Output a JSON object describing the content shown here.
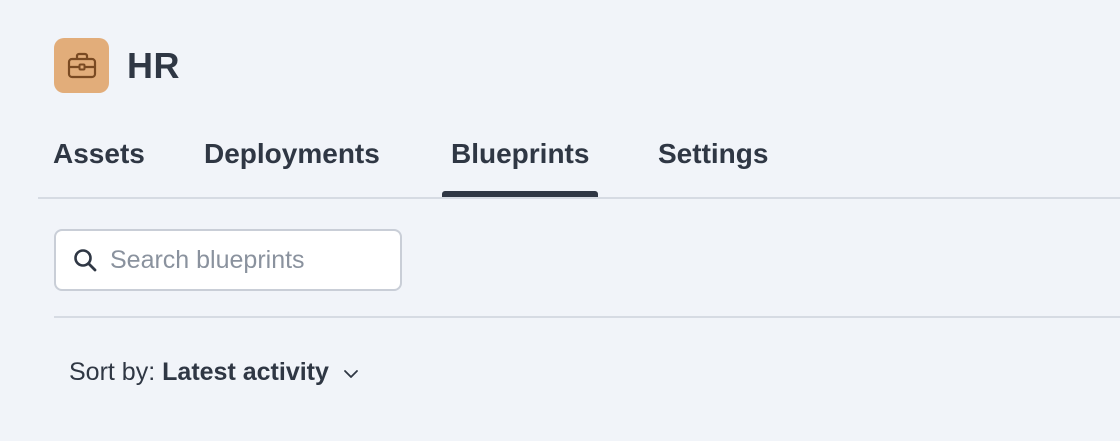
{
  "header": {
    "title": "HR",
    "icon": "briefcase-icon",
    "icon_bg": "#e2ad7a"
  },
  "tabs": [
    {
      "label": "Assets",
      "active": false
    },
    {
      "label": "Deployments",
      "active": false
    },
    {
      "label": "Blueprints",
      "active": true
    },
    {
      "label": "Settings",
      "active": false
    }
  ],
  "search": {
    "placeholder": "Search blueprints",
    "value": "",
    "icon": "search-icon"
  },
  "sort": {
    "label": "Sort by:",
    "value": "Latest activity",
    "icon": "chevron-down-icon"
  },
  "colors": {
    "background": "#f1f4f9",
    "text": "#2f3744",
    "accent": "#e2ad7a",
    "divider": "#d6dbe3"
  }
}
